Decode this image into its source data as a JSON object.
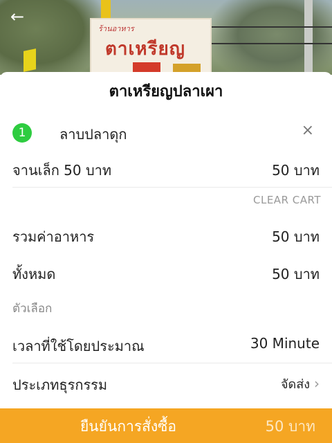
{
  "header": {
    "back_icon": "arrow-left-icon",
    "sign_small": "ร้านอาหาร",
    "sign_big": "ตาเหรียญ"
  },
  "restaurant": {
    "name": "ตาเหรียญปลาเผา"
  },
  "cart": {
    "items": [
      {
        "qty": "1",
        "name": "ลาบปลาดุก",
        "option_label": "จานเล็ก 50 บาท",
        "price": "50 บาท",
        "remove_icon": "close-icon"
      }
    ],
    "clear_label": "CLEAR CART"
  },
  "summary": {
    "subtotal_label": "รวมค่าอาหาร",
    "subtotal_value": "50 บาท",
    "total_label": "ทั้งหมด",
    "total_value": "50 บาท"
  },
  "options": {
    "section_label": "ตัวเลือก",
    "eta_label": "เวลาที่ใช้โดยประมาณ",
    "eta_value": "30 Minute",
    "type_label": "ประเภทธุรกรรม",
    "type_value": "จัดส่ง"
  },
  "confirm": {
    "label": "ยืนยันการสั่งซื้อ",
    "amount": "50 บาท"
  },
  "colors": {
    "accent": "#f5a623",
    "badge": "#2ecc40"
  }
}
